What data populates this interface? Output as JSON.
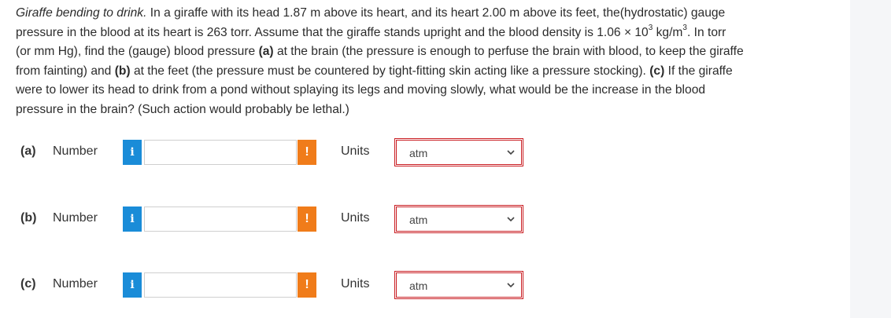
{
  "problem": {
    "title": "Giraffe bending to drink.",
    "line1_rest": " In a giraffe with its head 1.87 m above its heart, and its heart 2.00 m above its feet, the(hydrostatic) gauge",
    "line2_a": "pressure in the blood at its heart is 263 torr. Assume that the giraffe stands upright and the blood density is 1.06 × 10",
    "line2_exp1": "3",
    "line2_b": " kg/m",
    "line2_exp2": "3",
    "line2_c": ". In torr",
    "line3": "(or mm Hg), find the (gauge) blood pressure ",
    "part_a_marker": "(a)",
    "line3_rest": " at the brain (the pressure is enough to perfuse the brain with blood, to keep the giraffe",
    "line4": "from fainting) and ",
    "part_b_marker": "(b)",
    "line4_rest": " at the feet (the pressure must be countered by tight-fitting skin acting like a pressure stocking). ",
    "part_c_marker": "(c)",
    "line4_end": " If the giraffe",
    "line5": "were to lower its head to drink from a pond without splaying its legs and moving slowly, what would be the increase in the blood",
    "line6": "pressure in the brain? (Such action would probably be lethal.)"
  },
  "answers": [
    {
      "part": "(a)",
      "number_label": "Number",
      "info": "i",
      "value": "",
      "warn": "!",
      "units_label": "Units",
      "unit": "atm"
    },
    {
      "part": "(b)",
      "number_label": "Number",
      "info": "i",
      "value": "",
      "warn": "!",
      "units_label": "Units",
      "unit": "atm"
    },
    {
      "part": "(c)",
      "number_label": "Number",
      "info": "i",
      "value": "",
      "warn": "!",
      "units_label": "Units",
      "unit": "atm"
    }
  ],
  "colors": {
    "info": "#1a8cd8",
    "warn": "#f07c1a",
    "select_border": "#c91d22"
  },
  "icons": {
    "info": "info-icon",
    "warn": "warning-icon",
    "dropdown": "chevron-down-icon"
  }
}
